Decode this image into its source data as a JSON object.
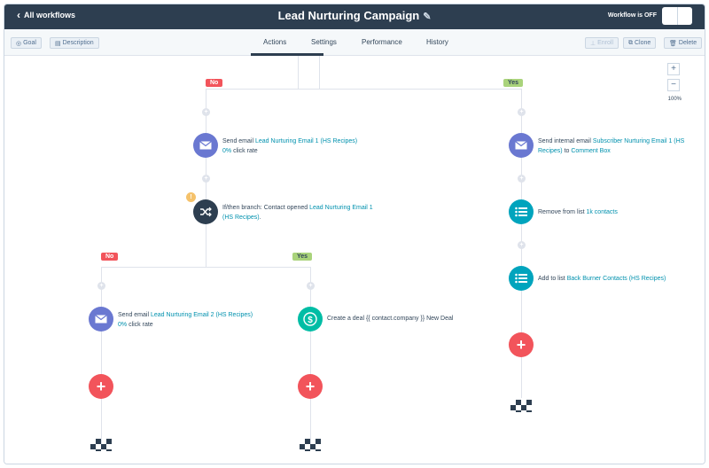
{
  "header": {
    "back_label": "All workflows",
    "title": "Lead Nurturing Campaign",
    "status": "Workflow is OFF"
  },
  "toolbar": {
    "goal_label": "Goal",
    "description_label": "Description",
    "tabs": [
      "Actions",
      "Settings",
      "Performance",
      "History"
    ],
    "active_tab": "Actions",
    "enroll_label": "Enroll",
    "clone_label": "Clone",
    "delete_label": "Delete"
  },
  "zoom": {
    "plus": "+",
    "minus": "−",
    "level": "100%"
  },
  "tags": {
    "no": "No",
    "yes": "Yes"
  },
  "left_branch": {
    "send_email": {
      "prefix": "Send email ",
      "link": "Lead Nurturing Email 1 (HS Recipes)",
      "rate": "0%",
      "rate_suffix": " click rate"
    },
    "if_then": {
      "prefix": "If/then branch: Contact opened ",
      "link": "Lead Nurturing Email 1 (HS Recipes)",
      "suffix": "."
    },
    "no_path": {
      "send_email": {
        "prefix": "Send email ",
        "link": "Lead Nurturing Email 2 (HS Recipes)",
        "rate": "0%",
        "rate_suffix": " click rate"
      }
    },
    "yes_path": {
      "create_deal": {
        "text": "Create a deal {{ contact.company }} New Deal"
      }
    }
  },
  "right_branch": {
    "internal_email": {
      "prefix": "Send internal email ",
      "link": "Subscriber Nurturing Email 1 (HS Recipes)",
      "middle": " to ",
      "link2": "Comment Box"
    },
    "remove_list": {
      "prefix": "Remove from list ",
      "link": "1k contacts"
    },
    "add_list": {
      "prefix": "Add to list ",
      "link": "Back Burner Contacts (HS Recipes)"
    }
  },
  "icons": {
    "add_plus": "+",
    "warning": "!",
    "dot": "+"
  }
}
